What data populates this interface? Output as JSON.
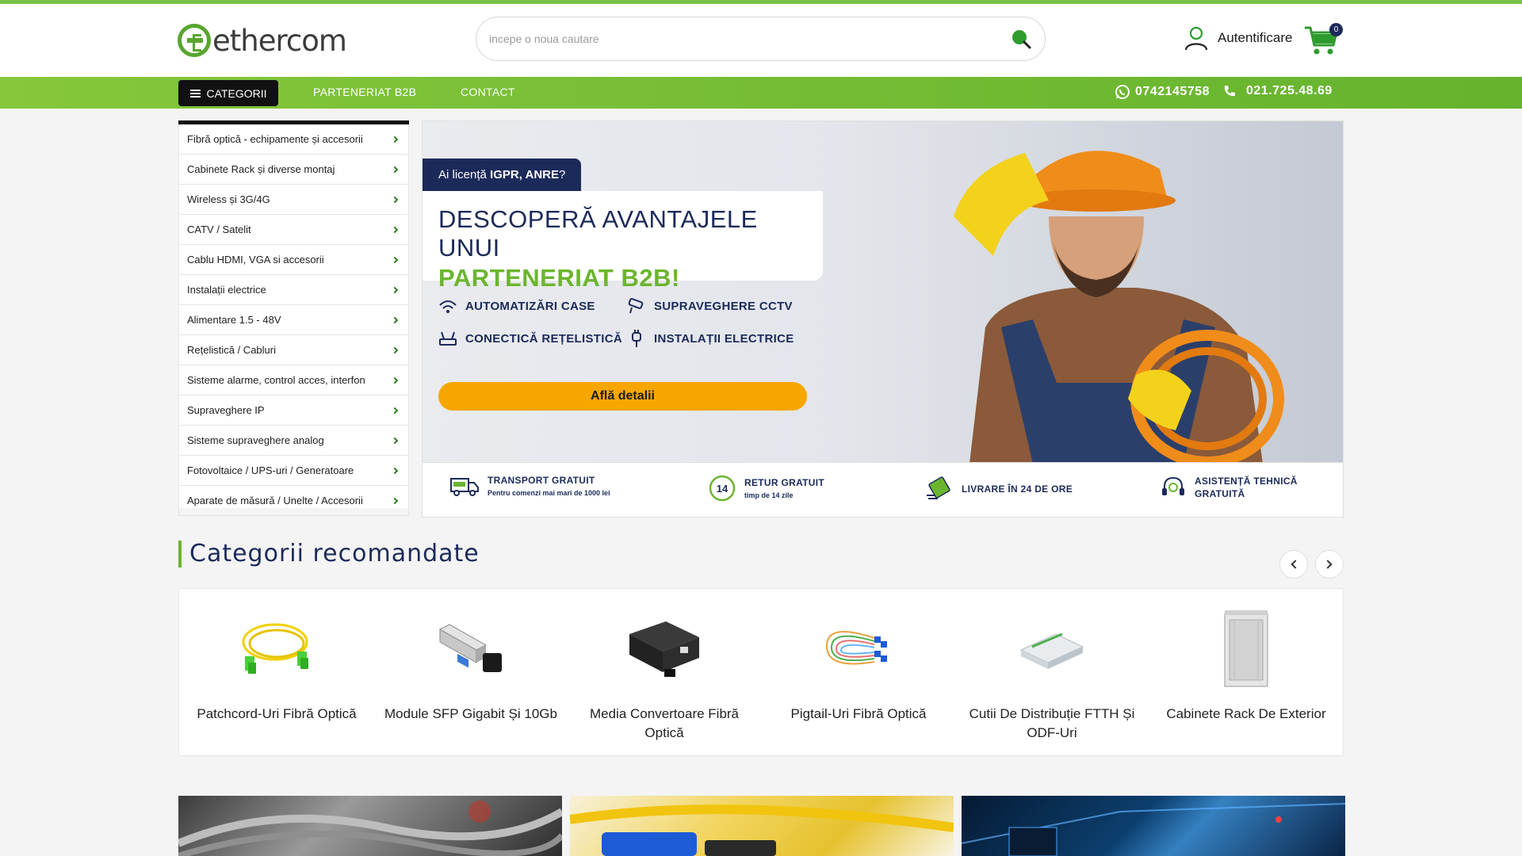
{
  "brand": {
    "name": "ethercom",
    "accent": "#6bb52e",
    "navy": "#1c2a5a",
    "cta_color": "#f7a600"
  },
  "search": {
    "placeholder": "incepe o noua cautare"
  },
  "account": {
    "login_label": "Autentificare",
    "cart_count": "0"
  },
  "nav": {
    "categories_label": "CATEGORII",
    "links": [
      "PARTENERIAT B2B",
      "CONTACT"
    ],
    "whatsapp": "0742145758",
    "phone": "021.725.48.69"
  },
  "sidebar": {
    "items": [
      "Fibră optică - echipamente și accesorii",
      "Cabinete Rack și diverse montaj",
      "Wireless și 3G/4G",
      "CATV / Satelit",
      "Cablu HDMI, VGA si accesorii",
      "Instalații electrice",
      "Alimentare 1.5 - 48V",
      "Rețelistică / Cabluri",
      "Sisteme alarme, control acces, interfon",
      "Supraveghere IP",
      "Sisteme supraveghere analog",
      "Fotovoltaice / UPS-uri / Generatoare",
      "Aparate de măsură / Unelte / Accesorii"
    ]
  },
  "hero": {
    "license_prefix": "Ai licență",
    "license_bold": "IGPR, ANRE",
    "license_suffix": "?",
    "title_line1": "DESCOPERĂ AVANTAJELE UNUI",
    "title_line2": "PARTENERIAT B2B!",
    "features": [
      "AUTOMATIZĂRI CASE",
      "SUPRAVEGHERE CCTV",
      "CONECTICĂ REȚELISTICĂ",
      "INSTALAȚII ELECTRICE"
    ],
    "cta": "Află detalii"
  },
  "usps": [
    {
      "title": "TRANSPORT GRATUIT",
      "sub": "Pentru comenzi mai mari de 1000 lei",
      "icon": "truck-icon"
    },
    {
      "title": "RETUR GRATUIT",
      "sub": "timp de 14 zile",
      "icon": "return-14-icon"
    },
    {
      "title": "LIVRARE ÎN 24 DE ORE",
      "sub": "",
      "icon": "fast-delivery-icon"
    },
    {
      "title": "ASISTENȚĂ TEHNICĂ",
      "title2": "GRATUITĂ",
      "sub": "",
      "icon": "tech-support-icon"
    }
  ],
  "recommended": {
    "title": "Categorii recomandate",
    "items": [
      {
        "label": "Patchcord-Uri Fibră Optică",
        "icon": "patchcord-icon"
      },
      {
        "label": "Module SFP Gigabit Și 10Gb",
        "icon": "sfp-module-icon"
      },
      {
        "label": "Media Convertoare Fibră Optică",
        "icon": "media-converter-icon"
      },
      {
        "label": "Pigtail-Uri Fibră Optică",
        "icon": "pigtail-icon"
      },
      {
        "label": "Cutii De Distribuție FTTH Și ODF-Uri",
        "icon": "distribution-box-icon"
      },
      {
        "label": "Cabinete Rack De Exterior",
        "icon": "outdoor-rack-icon"
      }
    ]
  }
}
